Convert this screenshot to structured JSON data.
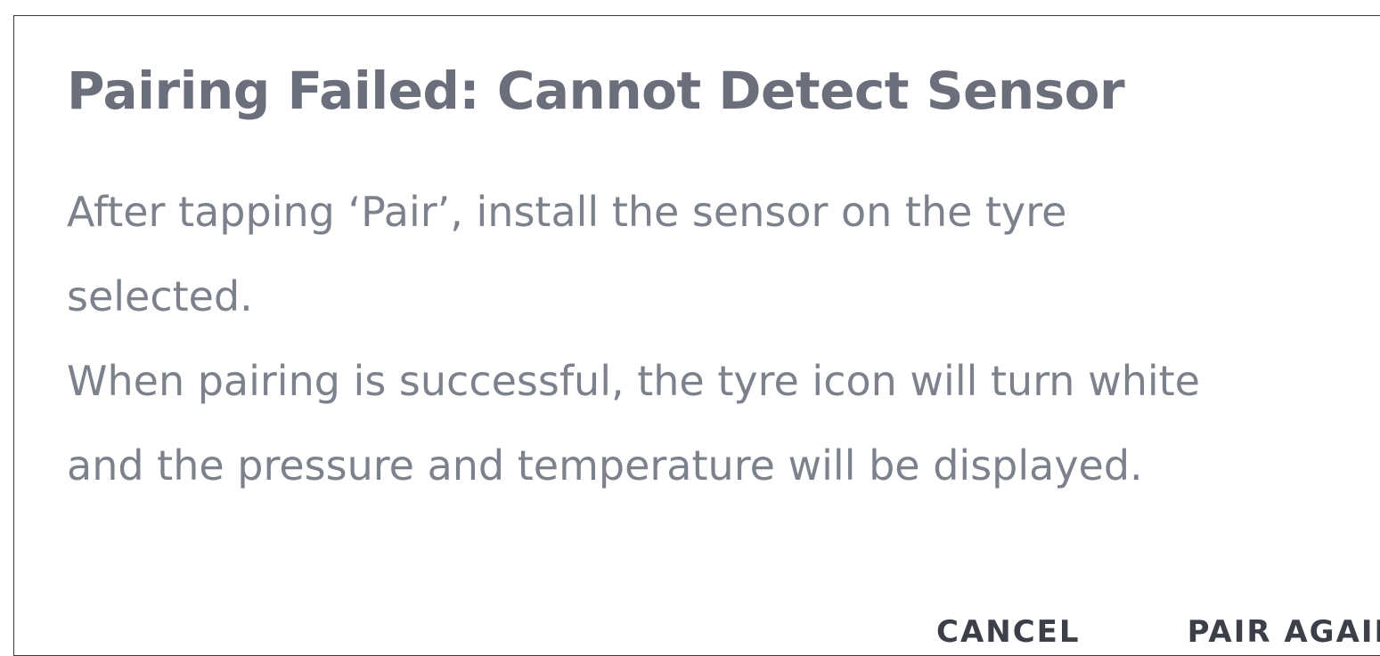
{
  "dialog": {
    "title": "Pairing Failed: Cannot Detect Sensor",
    "message": "After tapping ‘Pair’, install the sensor on the tyre\nselected.\nWhen pairing is successful, the tyre icon will turn white\nand the pressure and temperature will be displayed.",
    "actions": {
      "cancel_label": "CANCEL",
      "retry_label": "PAIR AGAIN"
    }
  }
}
